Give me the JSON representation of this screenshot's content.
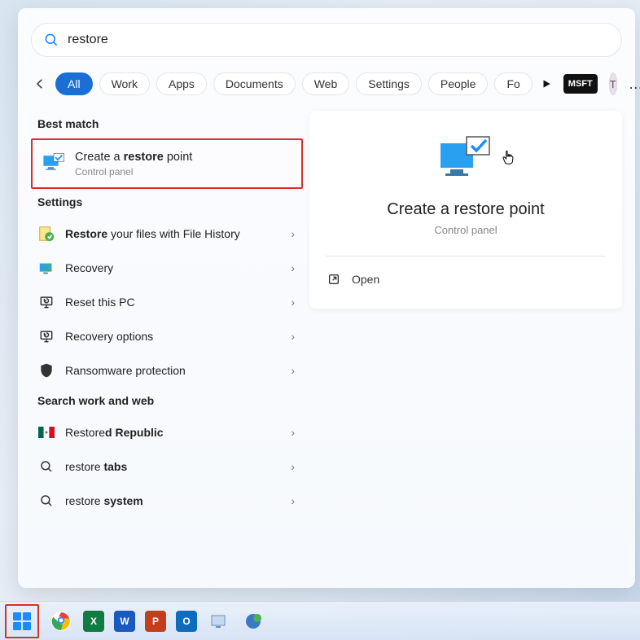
{
  "search": {
    "value": "restore"
  },
  "tabs": [
    "All",
    "Work",
    "Apps",
    "Documents",
    "Web",
    "Settings",
    "People",
    "Fo"
  ],
  "badge": "MSFT",
  "user_initial": "T",
  "sections": {
    "best_match_title": "Best match",
    "settings_title": "Settings",
    "web_title": "Search work and web"
  },
  "best_match": {
    "prefix": "Create a ",
    "bold": "restore",
    "suffix": " point",
    "subtitle": "Control panel"
  },
  "settings_items": [
    {
      "bold": "Restore",
      "rest": " your files with File History"
    },
    {
      "bold": "",
      "rest": "Recovery"
    },
    {
      "bold": "",
      "rest": "Reset this PC"
    },
    {
      "bold": "",
      "rest": "Recovery options"
    },
    {
      "bold": "",
      "rest": "Ransomware protection"
    }
  ],
  "web_items": [
    {
      "pre": "Restore",
      "bold": "d Republic",
      "mid": ""
    },
    {
      "pre": "restore ",
      "bold": "tabs",
      "mid": ""
    },
    {
      "pre": "restore ",
      "bold": "system",
      "mid": ""
    }
  ],
  "preview": {
    "title": "Create a restore point",
    "subtitle": "Control panel",
    "open": "Open"
  },
  "taskbar_apps": [
    {
      "name": "chrome",
      "bg": "",
      "letter": ""
    },
    {
      "name": "excel",
      "bg": "#107c41",
      "letter": "X"
    },
    {
      "name": "word",
      "bg": "#185abd",
      "letter": "W"
    },
    {
      "name": "powerpoint",
      "bg": "#c43e1c",
      "letter": "P"
    },
    {
      "name": "outlook",
      "bg": "#0f6cbd",
      "letter": "O"
    }
  ]
}
